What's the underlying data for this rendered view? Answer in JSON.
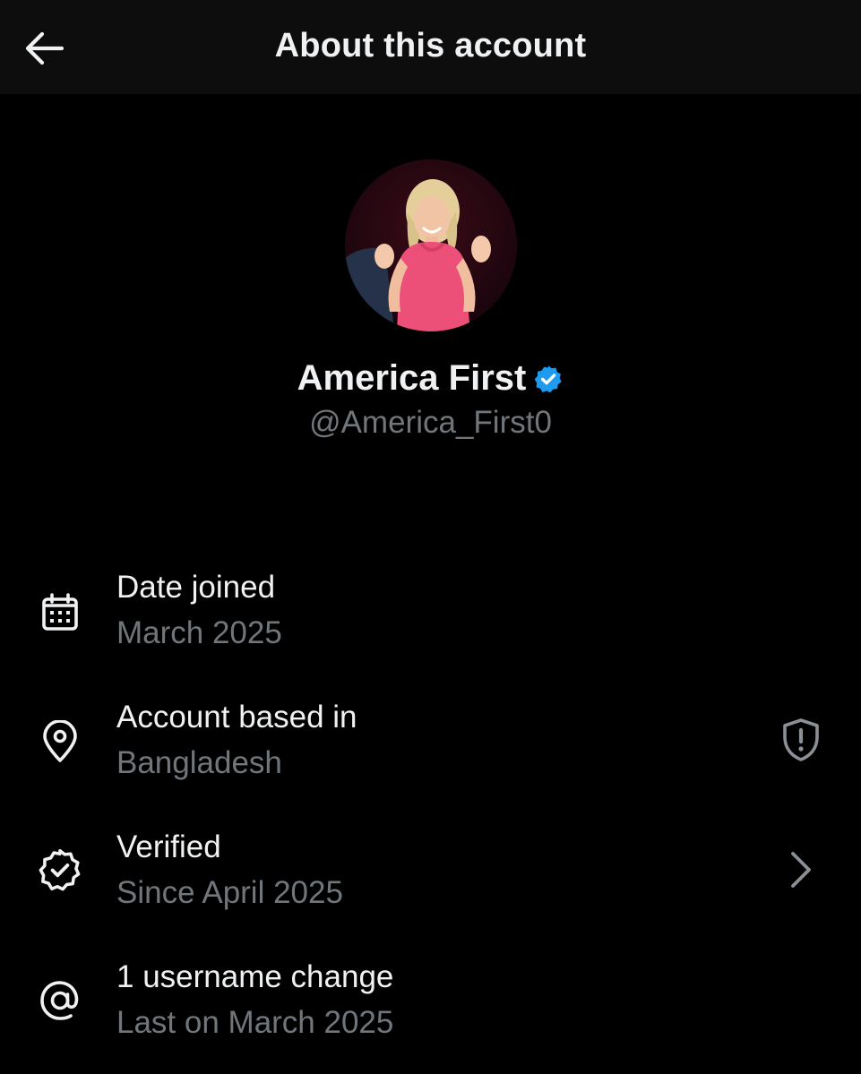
{
  "header": {
    "title": "About this account",
    "back_icon": "arrow-left-icon"
  },
  "profile": {
    "display_name": "America First",
    "handle": "@America_First0",
    "verified_badge_icon": "verified-badge-icon",
    "verified_badge_color": "#1d9bf0",
    "avatar_icon": "profile-photo"
  },
  "details": [
    {
      "icon": "calendar-icon",
      "title": "Date joined",
      "subtitle": "March 2025"
    },
    {
      "icon": "location-pin-icon",
      "title": "Account based in",
      "subtitle": "Bangladesh",
      "right_icon": "shield-alert-icon"
    },
    {
      "icon": "verified-outline-icon",
      "title": "Verified",
      "subtitle": "Since April 2025",
      "right_icon": "chevron-right-icon"
    },
    {
      "icon": "at-sign-icon",
      "title": "1 username change",
      "subtitle": "Last on March 2025"
    }
  ],
  "colors": {
    "background": "#000000",
    "header_background": "#0d0d0d",
    "primary_text": "#eff1f2",
    "secondary_text": "#71767b"
  }
}
